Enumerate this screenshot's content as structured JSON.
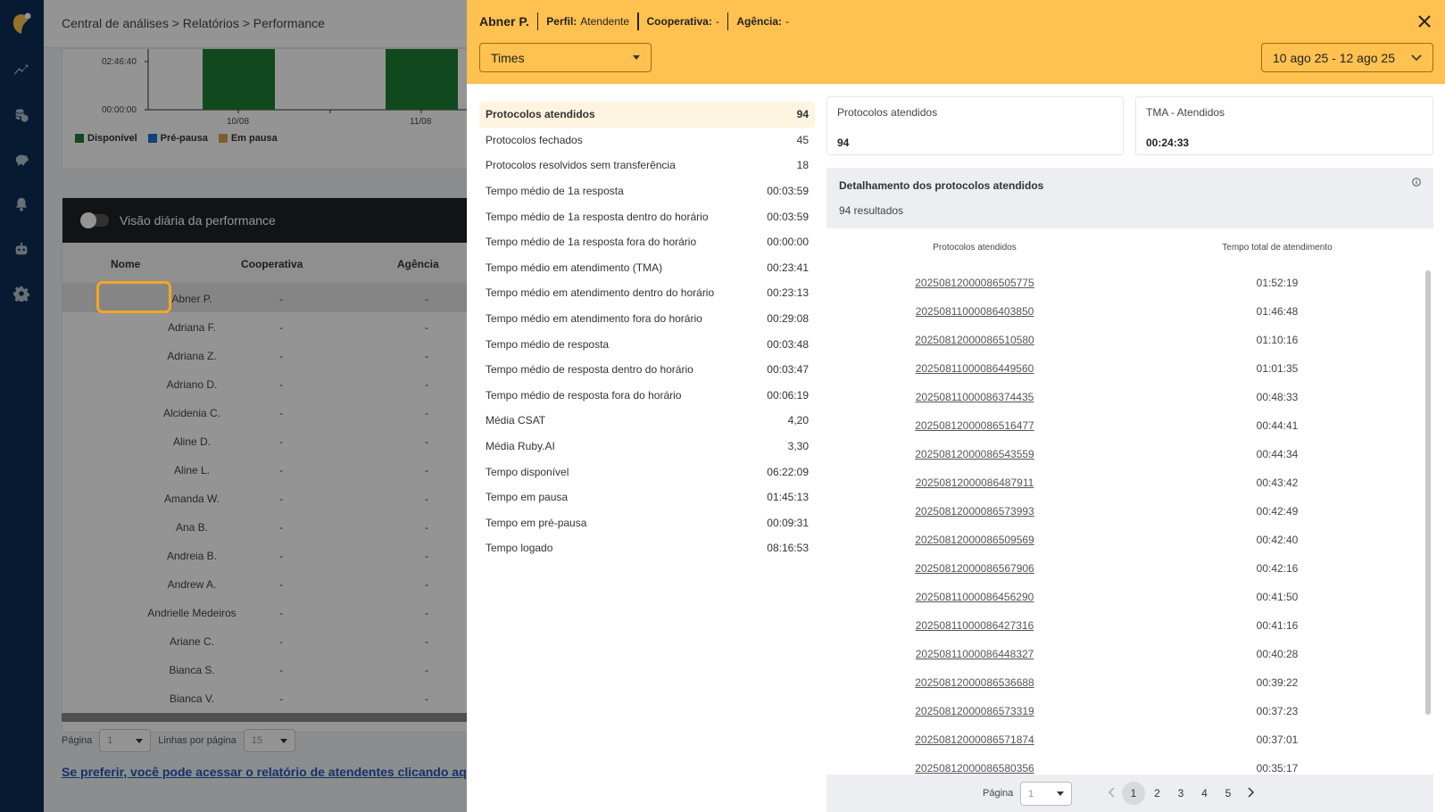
{
  "nav": {
    "icons": [
      "chart-line-icon",
      "coins-icon",
      "piggy-bank-icon",
      "bell-icon",
      "robot-icon",
      "gear-icon"
    ]
  },
  "background": {
    "breadcrumb": "Central de análises > Relatórios > Performance",
    "chart": {
      "y_ticks": [
        "02:46:40",
        "00:00:00"
      ],
      "x_ticks": [
        "10/08",
        "11/08"
      ],
      "legend": [
        "Disponível",
        "Pré-pausa",
        "Em pausa"
      ],
      "colors": {
        "disponivel": "#1e7e34",
        "pre_pausa": "#1f72c8",
        "em_pausa": "#d8a44a"
      }
    },
    "performance": {
      "toggle_label": "Visão diária da performance",
      "columns": [
        "Nome",
        "Cooperativa",
        "Agência"
      ],
      "rows": [
        {
          "name": "Abner P.",
          "coop": "-",
          "ag": "-"
        },
        {
          "name": "Adriana F.",
          "coop": "-",
          "ag": "-"
        },
        {
          "name": "Adriana Z.",
          "coop": "-",
          "ag": "-"
        },
        {
          "name": "Adriano D.",
          "coop": "-",
          "ag": "-"
        },
        {
          "name": "Alcidenia C.",
          "coop": "-",
          "ag": "-"
        },
        {
          "name": "Aline D.",
          "coop": "-",
          "ag": "-"
        },
        {
          "name": "Aline L.",
          "coop": "-",
          "ag": "-"
        },
        {
          "name": "Amanda W.",
          "coop": "-",
          "ag": "-"
        },
        {
          "name": "Ana B.",
          "coop": "-",
          "ag": "-"
        },
        {
          "name": "Andreia B.",
          "coop": "-",
          "ag": "-"
        },
        {
          "name": "Andrew A.",
          "coop": "-",
          "ag": "-"
        },
        {
          "name": "Andrielle Medeiros",
          "coop": "-",
          "ag": "-"
        },
        {
          "name": "Ariane C.",
          "coop": "-",
          "ag": "-"
        },
        {
          "name": "Bianca S.",
          "coop": "-",
          "ag": "-"
        },
        {
          "name": "Bianca V.",
          "coop": "-",
          "ag": "-"
        }
      ],
      "pager_page_label": "Página",
      "pager_page_value": "1",
      "pager_lines_label": "Linhas por página",
      "pager_lines_value": "15"
    },
    "link": "Se preferir, você pode acessar o relatório de atendentes clicando aqui."
  },
  "drawer": {
    "name": "Abner P.",
    "perfil_label": "Perfil:",
    "perfil_value": "Atendente",
    "coop_label": "Cooperativa:",
    "coop_value": "-",
    "agencia_label": "Agência:",
    "agencia_value": "-",
    "times_select": "Times",
    "date_range": "10 ago 25 - 12 ago 25",
    "metrics": [
      {
        "label": "Protocolos atendidos",
        "value": "94"
      },
      {
        "label": "Protocolos fechados",
        "value": "45"
      },
      {
        "label": "Protocolos resolvidos sem transferência",
        "value": "18"
      },
      {
        "label": "Tempo médio de 1a resposta",
        "value": "00:03:59"
      },
      {
        "label": "Tempo médio de 1a resposta dentro do horário",
        "value": "00:03:59"
      },
      {
        "label": "Tempo médio de 1a resposta fora do horário",
        "value": "00:00:00"
      },
      {
        "label": "Tempo médio em atendimento (TMA)",
        "value": "00:23:41"
      },
      {
        "label": "Tempo médio em atendimento dentro do horário",
        "value": "00:23:13"
      },
      {
        "label": "Tempo médio em atendimento fora do horário",
        "value": "00:29:08"
      },
      {
        "label": "Tempo médio de resposta",
        "value": "00:03:48"
      },
      {
        "label": "Tempo médio de resposta dentro do horário",
        "value": "00:03:47"
      },
      {
        "label": "Tempo médio de resposta fora do horário",
        "value": "00:06:19"
      },
      {
        "label": "Média CSAT",
        "value": "4,20"
      },
      {
        "label": "Média Ruby.AI",
        "value": "3,30"
      },
      {
        "label": "Tempo disponível",
        "value": "06:22:09"
      },
      {
        "label": "Tempo em pausa",
        "value": "01:45:13"
      },
      {
        "label": "Tempo em pré-pausa",
        "value": "00:09:31"
      },
      {
        "label": "Tempo logado",
        "value": "08:16:53"
      }
    ],
    "card1": {
      "label": "Protocolos atendidos",
      "value": "94"
    },
    "card2": {
      "label": "TMA - Atendidos",
      "value": "00:24:33"
    },
    "detail_title": "Detalhamento dos protocolos atendidos",
    "detail_count": "94 resultados",
    "table_columns": [
      "Protocolos atendidos",
      "Tempo total de atendimento"
    ],
    "table_rows": [
      {
        "protocol": "20250812000086505775",
        "time": "01:52:19"
      },
      {
        "protocol": "20250811000086403850",
        "time": "01:46:48"
      },
      {
        "protocol": "20250812000086510580",
        "time": "01:10:16"
      },
      {
        "protocol": "20250811000086449560",
        "time": "01:01:35"
      },
      {
        "protocol": "20250811000086374435",
        "time": "00:48:33"
      },
      {
        "protocol": "20250812000086516477",
        "time": "00:44:41"
      },
      {
        "protocol": "20250812000086543559",
        "time": "00:44:34"
      },
      {
        "protocol": "20250812000086487911",
        "time": "00:43:42"
      },
      {
        "protocol": "20250812000086573993",
        "time": "00:42:49"
      },
      {
        "protocol": "20250812000086509569",
        "time": "00:42:40"
      },
      {
        "protocol": "20250812000086567906",
        "time": "00:42:16"
      },
      {
        "protocol": "20250811000086456290",
        "time": "00:41:50"
      },
      {
        "protocol": "20250811000086427316",
        "time": "00:41:16"
      },
      {
        "protocol": "20250811000086448327",
        "time": "00:40:28"
      },
      {
        "protocol": "20250812000086536688",
        "time": "00:39:22"
      },
      {
        "protocol": "20250812000086573319",
        "time": "00:37:23"
      },
      {
        "protocol": "20250812000086571874",
        "time": "00:37:01"
      },
      {
        "protocol": "20250812000086580356",
        "time": "00:35:17"
      }
    ],
    "pager_label": "Página",
    "pager_select": "1",
    "pages": [
      "1",
      "2",
      "3",
      "4",
      "5"
    ],
    "current_page": "1"
  }
}
